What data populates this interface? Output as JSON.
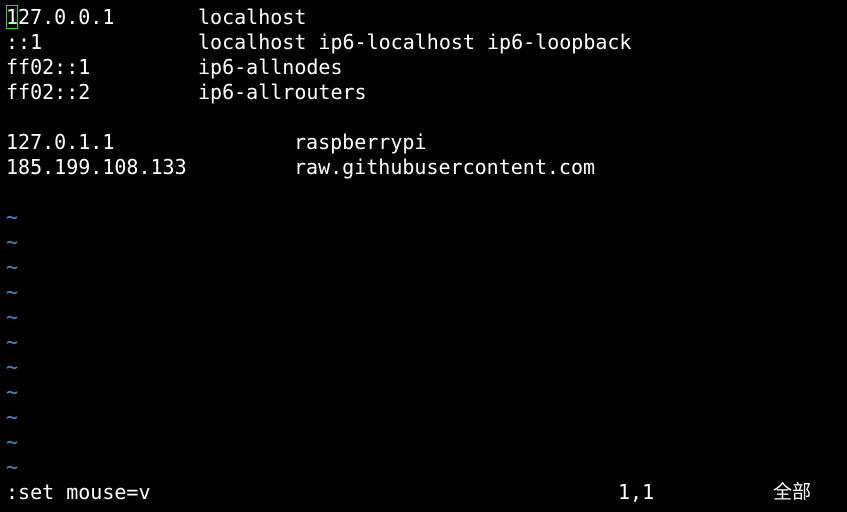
{
  "hosts": [
    {
      "ip_first": "1",
      "ip_rest": "27.0.0.1",
      "names": "localhost"
    },
    {
      "ip": "::1",
      "names": "localhost ip6-localhost ip6-loopback"
    },
    {
      "ip": "ff02::1",
      "names": "ip6-allnodes"
    },
    {
      "ip": "ff02::2",
      "names": "ip6-allrouters"
    },
    {
      "ip": "127.0.1.1",
      "names": "raspberrypi"
    },
    {
      "ip": "185.199.108.133",
      "names": "raw.githubusercontent.com"
    }
  ],
  "empty_marker": "~",
  "status": {
    "command": ":set mouse=v",
    "cursor_position": "1,1",
    "scroll_position": "全部"
  },
  "colors": {
    "background": "#000000",
    "text": "#ffffff",
    "tilde": "#3a8fd0",
    "cursor_outline": "#2bd42b"
  }
}
